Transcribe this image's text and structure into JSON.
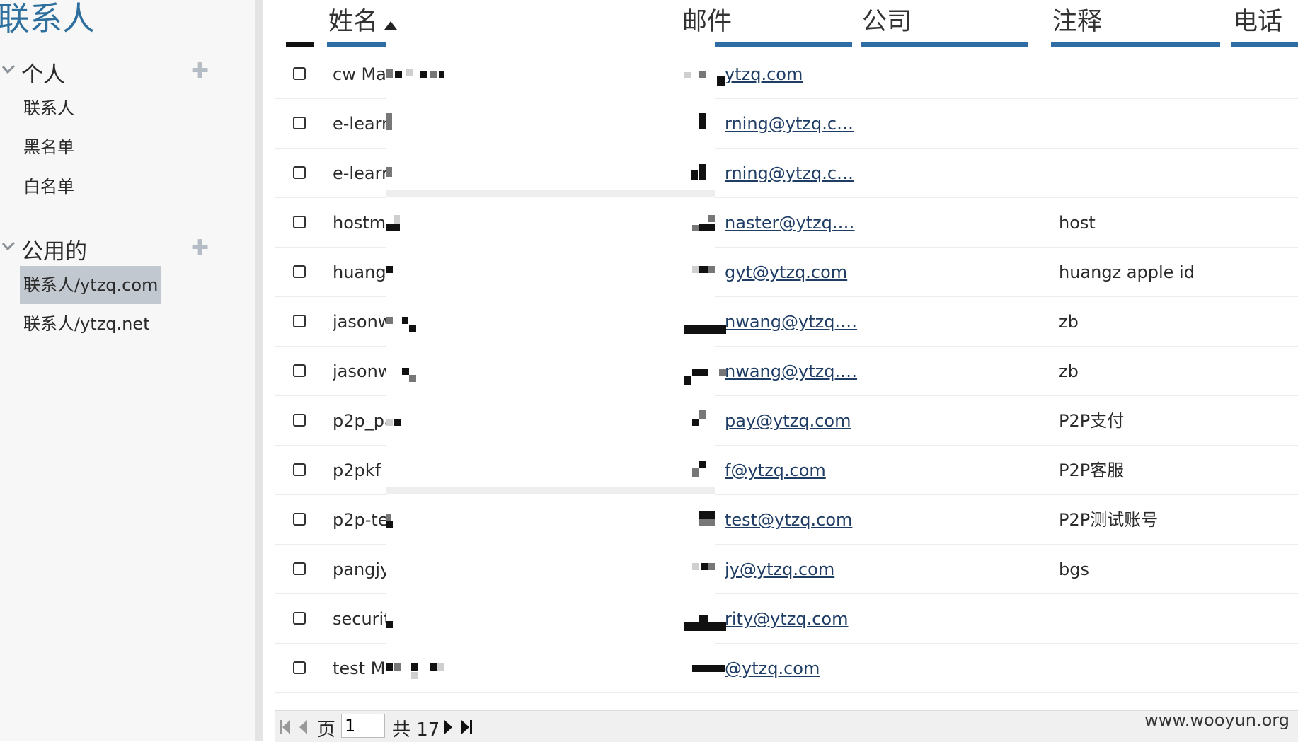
{
  "app_title": "联系人",
  "sidebar": {
    "groups": [
      {
        "label": "个人",
        "items": [
          {
            "label": "联系人"
          },
          {
            "label": "黑名单"
          },
          {
            "label": "白名单"
          }
        ]
      },
      {
        "label": "公用的",
        "items": [
          {
            "label": "联系人/ytzq.com",
            "active": true
          },
          {
            "label": "联系人/ytzq.net"
          }
        ]
      }
    ]
  },
  "table": {
    "columns": [
      "姓名",
      "邮件",
      "公司",
      "注释",
      "电话"
    ],
    "sort_column": "姓名",
    "sort_direction": "ascending",
    "rows": [
      {
        "name": "cw Ma",
        "email": "ytzq.com",
        "note": ""
      },
      {
        "name": "e-learr",
        "email": "rning@ytzq.c…",
        "note": ""
      },
      {
        "name": "e-learr",
        "email": "rning@ytzq.c…",
        "note": ""
      },
      {
        "name": "hostma",
        "email": "naster@ytzq.…",
        "note": "host"
      },
      {
        "name": "huang",
        "email": "gyt@ytzq.com",
        "note": "huangz apple id"
      },
      {
        "name": "jasonw",
        "email": "nwang@ytzq.…",
        "note": "zb"
      },
      {
        "name": "jasonw",
        "email": "nwang@ytzq.…",
        "note": "zb"
      },
      {
        "name": "p2p_pa",
        "email": "pay@ytzq.com",
        "note": "P2P支付"
      },
      {
        "name": "p2pkf",
        "email": "f@ytzq.com",
        "note": "P2P客服"
      },
      {
        "name": "p2p-te",
        "email": "test@ytzq.com",
        "note": "P2P测试账号"
      },
      {
        "name": "pangjy",
        "email": "jy@ytzq.com",
        "note": "bgs"
      },
      {
        "name": "securit",
        "email": "rity@ytzq.com",
        "note": ""
      },
      {
        "name": "test Ma",
        "email": "@ytzq.com",
        "note": ""
      }
    ]
  },
  "pager": {
    "page_label": "页",
    "current_page": "1",
    "total_label": "共 17"
  },
  "watermark": "www.wooyun.org",
  "colors": {
    "accent": "#2f6ea5",
    "title": "#2e6f9e",
    "active_item_bg": "#c2c8cf",
    "link": "#1f3d64"
  }
}
